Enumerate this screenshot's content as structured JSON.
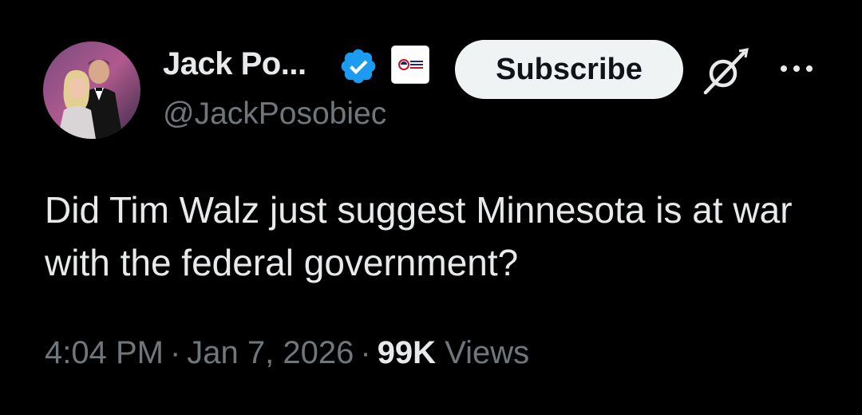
{
  "author": {
    "display_name": "Jack Po...",
    "handle": "@JackPosobiec",
    "verified_icon": "verified-badge-icon",
    "affiliate_icon": "affiliate-logo-icon"
  },
  "actions": {
    "subscribe_label": "Subscribe",
    "grok_icon": "grok-icon",
    "more_icon": "more-dots-icon"
  },
  "tweet": {
    "text": "Did Tim Walz just suggest Minnesota is at war with the federal government?"
  },
  "meta": {
    "time": "4:04 PM",
    "separator": "·",
    "date": "Jan 7, 2026",
    "views_count": "99K",
    "views_label": "Views"
  },
  "colors": {
    "background": "#000000",
    "primary_text": "#e7e9ea",
    "secondary_text": "#71767b",
    "verified_blue": "#1d9bf0",
    "subscribe_bg": "#eff3f4"
  }
}
